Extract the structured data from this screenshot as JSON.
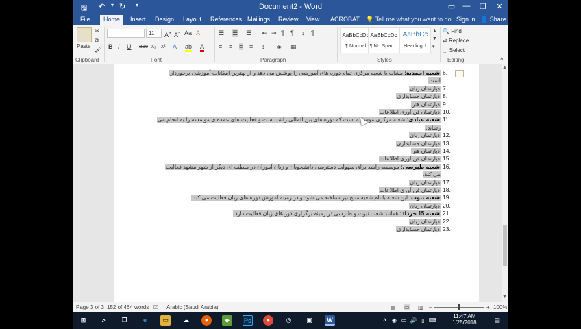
{
  "titlebar": {
    "title": "Document2 - Word",
    "qa_save": "🖫",
    "qa_undo": "↶",
    "qa_redo": "↻",
    "qa_more": "▾",
    "ribbon_opts": "▭",
    "minimize": "—",
    "restore": "❐",
    "close": "✕"
  },
  "tabs": {
    "items": [
      "File",
      "Home",
      "Insert",
      "Design",
      "Layout",
      "References",
      "Mailings",
      "Review",
      "View",
      "ACROBAT"
    ],
    "tell_me": "Tell me what you want to do...",
    "sign_in": "Sign in",
    "share": "Share"
  },
  "ribbon": {
    "clipboard": {
      "paste": "Paste",
      "label": "Clipboard"
    },
    "font": {
      "size": "11",
      "label": "Font",
      "bold": "B",
      "italic": "I",
      "underline": "U",
      "strike": "abc",
      "sub": "x₂",
      "sup": "x²"
    },
    "paragraph": {
      "label": "Paragraph"
    },
    "styles": {
      "label": "Styles",
      "items": [
        {
          "sample": "AaBbCcDc",
          "name": "¶ Normal"
        },
        {
          "sample": "AaBbCcDc",
          "name": "¶ No Spac..."
        },
        {
          "sample": "AaBbCc",
          "name": "Heading 1"
        }
      ]
    },
    "editing": {
      "find": "Find",
      "replace": "Replace",
      "select": "Select",
      "label": "Editing"
    }
  },
  "document": {
    "lines": [
      {
        "num": "6.",
        "bold": "شعبه احمدیة:",
        "text": " مشابه با شعبه مرکزی تمام دوره های آموزشی را پوشش می دهد و از بهترین امکانات آموزشی برخوردار",
        "cont": "است."
      },
      {
        "num": "7.",
        "text": "دپارتمان زبان"
      },
      {
        "num": "8.",
        "text": "دپارتمان حسابداری"
      },
      {
        "num": "9.",
        "text": "دپارتمان هنر"
      },
      {
        "num": "10.",
        "text": "دپارتمان فن آوری اطلاعات"
      },
      {
        "num": "11.",
        "bold": "شعبه عبادی:",
        "text": " شعبه مرکزی موسسه است که دوره های بین المللی راشد است و فعالیت های عمده ی موسسه را به انجام می",
        "cont": "رساند."
      },
      {
        "num": "12.",
        "text": "دپارتمان زبان"
      },
      {
        "num": "13.",
        "text": "دپارتمان حسابداری"
      },
      {
        "num": "14.",
        "text": "دپارتمان هنر"
      },
      {
        "num": "15.",
        "text": "دپارتمان فن آوری اطلاعات"
      },
      {
        "num": "16.",
        "bold": "شعبه طبرسی:",
        "text": " موسسه راشد برای سهولت دسترسی دانشجویان و زبان آموزان در منطقه ای دیگر از شهر مشهد فعالیت",
        "cont": "می کند."
      },
      {
        "num": "17.",
        "text": "دپارتمان زبان"
      },
      {
        "num": "18.",
        "text": "دپارتمان فن آوری اطلاعات"
      },
      {
        "num": "19.",
        "bold": "شعبه نبوت:",
        "text": " این شعبه با نام شعبه منتج نیز شناخته می شود و در زمینه آموزش دوره های زبان فعالیت می کند."
      },
      {
        "num": "20.",
        "text": "دپارتمان زبان"
      },
      {
        "num": "21.",
        "bold": "شعبه 15 خرداد:",
        "text": " همانند شعب نبوت و طبرسی در زمینه برگزاری دور های زبان فعالیت دارد."
      },
      {
        "num": "22.",
        "text": "دپارتمان زبان"
      },
      {
        "num": "23.",
        "text": "دپارتمان حسابداری"
      }
    ]
  },
  "status": {
    "page": "Page 3 of 3",
    "words": "152 of 464 words",
    "language": "Arabic (Saudi Arabia)",
    "zoom_minus": "–",
    "zoom_plus": "+",
    "zoom": "100%"
  },
  "tray": {
    "time": "11:47 AM",
    "date": "1/25/2018"
  },
  "colors": {
    "word_blue": "#2b579a",
    "highlight": "#c8c8c8",
    "taskbar": "#0f1a2b"
  }
}
